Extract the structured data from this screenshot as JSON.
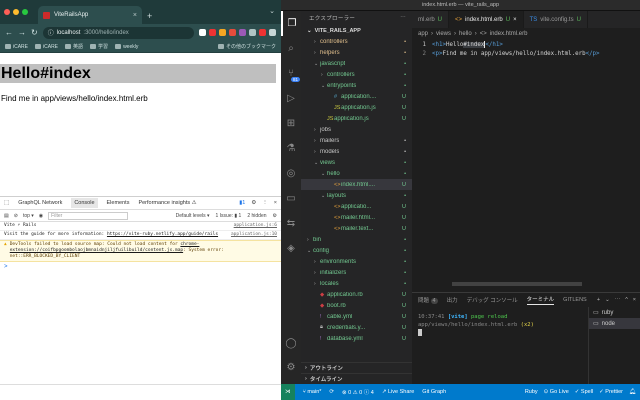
{
  "chrome": {
    "tab_title": "ViteRailsApp",
    "tab_close": "×",
    "new_tab": "+",
    "menu_chevron": "⌄",
    "nav": {
      "back": "←",
      "forward": "→",
      "reload": "↻"
    },
    "url_host": "localhost",
    "url_path": ":3000/hello/index",
    "bookmarks": [
      "iCARE",
      "iCARE",
      "英語",
      "学習",
      "weekly",
      "その他のブックマーク"
    ],
    "page": {
      "heading": "Hello#index",
      "paragraph": "Find me in app/views/hello/index.html.erb"
    },
    "devtools": {
      "tabs": [
        "GraphQL Network",
        "Console",
        "Elements",
        "Performance insights ⚠"
      ],
      "active_tab": "Console",
      "top_label": "top ▾",
      "filter_placeholder": "Filter",
      "levels": "Default levels ▾",
      "issues": "1 Issue: ▮ 1",
      "hidden": "2 hidden",
      "logs": [
        {
          "text": "Vite ⚡ Rails",
          "src": "application.js:6"
        },
        {
          "text": "Visit the guide for more information: ",
          "link": "https://vite-ruby.netlify.app/guide/rails",
          "src": "application.js:10"
        },
        {
          "text": "DevTools failed to load source map: Could not load content for ",
          "link": "chrome-extension://coifbpgoombolaojbmnaidnjiljfuilibuild/content.js.map",
          "tail": ": System error: net::ERR_BLOCKED_BY_CLIENT",
          "warn": true
        }
      ],
      "prompt": ">"
    }
  },
  "vscode": {
    "window_title": "index.html.erb — vite_rails_app",
    "explorer_title": "エクスプローラー",
    "project": "VITE_RAILS_APP",
    "tree": [
      {
        "name": "controllers",
        "indent": 1,
        "kind": "folder",
        "open": false,
        "status": "•",
        "color": "#e2c08d"
      },
      {
        "name": "helpers",
        "indent": 1,
        "kind": "folder",
        "open": false,
        "status": "•",
        "color": "#e2c08d"
      },
      {
        "name": "javascript",
        "indent": 1,
        "kind": "folder",
        "open": true,
        "status": "•",
        "color": "#73c991"
      },
      {
        "name": "controllers",
        "indent": 2,
        "kind": "folder",
        "open": false,
        "status": "•",
        "color": "#73c991"
      },
      {
        "name": "entrypoints",
        "indent": 2,
        "kind": "folder",
        "open": true,
        "status": "•",
        "color": "#73c991"
      },
      {
        "name": "application....",
        "indent": 3,
        "kind": "css",
        "status": "U",
        "color": "#73c991"
      },
      {
        "name": "application.js",
        "indent": 3,
        "kind": "js",
        "status": "U",
        "color": "#73c991"
      },
      {
        "name": "application.js",
        "indent": 2,
        "kind": "js",
        "status": "U",
        "color": "#73c991"
      },
      {
        "name": "jobs",
        "indent": 1,
        "kind": "folder",
        "open": false,
        "status": "",
        "color": "#c6c6c6"
      },
      {
        "name": "mailers",
        "indent": 1,
        "kind": "folder",
        "open": false,
        "status": "•",
        "color": "#c6c6c6"
      },
      {
        "name": "models",
        "indent": 1,
        "kind": "folder",
        "open": false,
        "status": "•",
        "color": "#c6c6c6"
      },
      {
        "name": "views",
        "indent": 1,
        "kind": "folder",
        "open": true,
        "status": "•",
        "color": "#73c991"
      },
      {
        "name": "hello",
        "indent": 2,
        "kind": "folder",
        "open": true,
        "status": "•",
        "color": "#73c991"
      },
      {
        "name": "index.html....",
        "indent": 3,
        "kind": "erb",
        "status": "U",
        "color": "#73c991",
        "selected": true
      },
      {
        "name": "layouts",
        "indent": 2,
        "kind": "folder",
        "open": true,
        "status": "•",
        "color": "#73c991"
      },
      {
        "name": "applicatio...",
        "indent": 3,
        "kind": "erb",
        "status": "U",
        "color": "#73c991"
      },
      {
        "name": "mailer.html...",
        "indent": 3,
        "kind": "erb",
        "status": "U",
        "color": "#73c991"
      },
      {
        "name": "mailer.text...",
        "indent": 3,
        "kind": "erb",
        "status": "U",
        "color": "#73c991"
      },
      {
        "name": "bin",
        "indent": 0,
        "kind": "folder",
        "open": false,
        "status": "•",
        "color": "#73c991"
      },
      {
        "name": "config",
        "indent": 0,
        "kind": "folder",
        "open": true,
        "status": "•",
        "color": "#73c991"
      },
      {
        "name": "environments",
        "indent": 1,
        "kind": "folder",
        "open": false,
        "status": "•",
        "color": "#73c991"
      },
      {
        "name": "initializers",
        "indent": 1,
        "kind": "folder",
        "open": false,
        "status": "•",
        "color": "#73c991"
      },
      {
        "name": "locales",
        "indent": 1,
        "kind": "folder",
        "open": false,
        "status": "•",
        "color": "#73c991"
      },
      {
        "name": "application.rb",
        "indent": 1,
        "kind": "rb",
        "status": "U",
        "color": "#73c991"
      },
      {
        "name": "boot.rb",
        "indent": 1,
        "kind": "rb",
        "status": "U",
        "color": "#73c991"
      },
      {
        "name": "cable.yml",
        "indent": 1,
        "kind": "yml",
        "status": "U",
        "color": "#73c991"
      },
      {
        "name": "credentials.y...",
        "indent": 1,
        "kind": "lock",
        "status": "U",
        "color": "#73c991"
      },
      {
        "name": "database.yml",
        "indent": 1,
        "kind": "yml",
        "status": "U",
        "color": "#73c991"
      }
    ],
    "outline_label": "アウトライン",
    "timeline_label": "タイムライン",
    "editor_tabs": [
      {
        "label": "ml.erb",
        "status": "U",
        "active": false
      },
      {
        "label": "index.html.erb",
        "status": "U",
        "active": true,
        "close": "×"
      },
      {
        "label": "vite.config.ts",
        "status": "U",
        "active": false
      }
    ],
    "breadcrumbs": [
      "app",
      "views",
      "hello",
      "index.html.erb"
    ],
    "code_lines": [
      {
        "no": "1",
        "open_tag": "<h1>",
        "pre": "Hello",
        "hl": "#index",
        "close_tag": "</h1>"
      },
      {
        "no": "2",
        "open_tag": "<p>",
        "pre": "Find me in app/views/hello/index.html.erb",
        "hl": "",
        "close_tag": "</p>"
      }
    ],
    "panel_tabs": [
      "問題",
      "出力",
      "デバッグ コンソール",
      "ターミナル",
      "GITLENS"
    ],
    "panel_badge": "4",
    "active_panel_tab": "ターミナル",
    "panel_controls": [
      "+",
      "⌄",
      "⋯",
      "^",
      "×"
    ],
    "terminal": {
      "time": "10:37:41",
      "tag": "[vite]",
      "action": "page reload",
      "file": "app/views/hello/index.html.erb",
      "count": "(x2)"
    },
    "terminal_list": [
      "ruby",
      "node"
    ],
    "status": {
      "branch": "main*",
      "sync": "⟳",
      "problems": "⊗ 0 ⚠ 0 ⓘ 4",
      "live_share": "Live Share",
      "git_graph": "Git Graph",
      "right": [
        "Ruby",
        "Go Live",
        "Spell",
        "Prettier"
      ]
    }
  }
}
